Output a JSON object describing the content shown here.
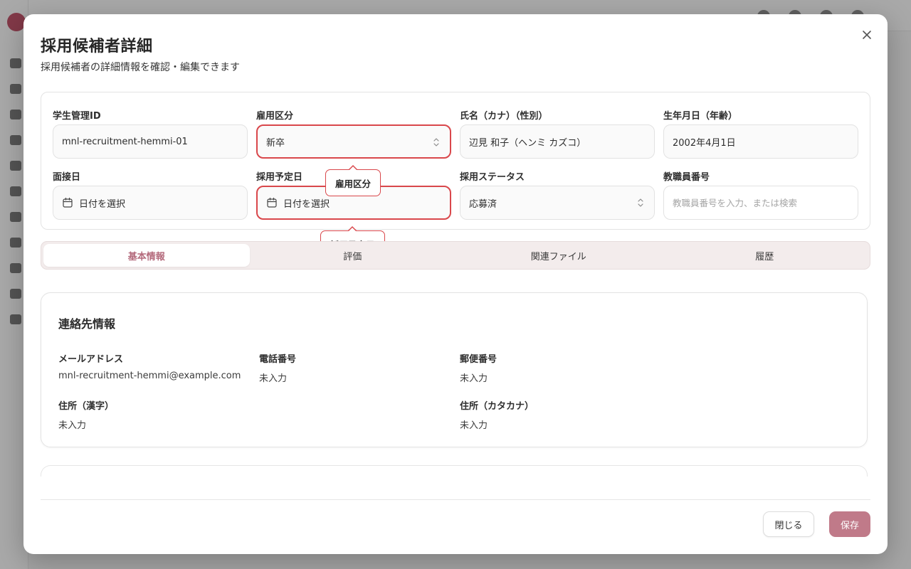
{
  "modal": {
    "title": "採用候補者詳細",
    "subtitle": "採用候補者の詳細情報を確認・編集できます"
  },
  "form": {
    "student_id": {
      "label": "学生管理ID",
      "value": "mnl-recruitment-hemmi-01"
    },
    "employment_type": {
      "label": "雇用区分",
      "value": "新卒"
    },
    "name": {
      "label": "氏名（カナ）（性別）",
      "value": "辺見 和子（ヘンミ カズコ）"
    },
    "birthdate": {
      "label": "生年月日（年齢）",
      "value": "2002年4月1日"
    },
    "interview_date": {
      "label": "面接日",
      "value": "日付を選択"
    },
    "planned_hire_date": {
      "label": "採用予定日",
      "value": "日付を選択"
    },
    "hire_status": {
      "label": "採用ステータス",
      "value": "応募済"
    },
    "staff_number": {
      "label": "教職員番号",
      "placeholder": "教職員番号を入力、または検索"
    }
  },
  "tooltips": {
    "employment_type": "雇用区分",
    "planned_hire_date": "採用予定日"
  },
  "tabs": [
    {
      "label": "基本情報",
      "active": true
    },
    {
      "label": "評価",
      "active": false
    },
    {
      "label": "関連ファイル",
      "active": false
    },
    {
      "label": "履歴",
      "active": false
    }
  ],
  "contact": {
    "title": "連絡先情報",
    "email": {
      "label": "メールアドレス",
      "value": "mnl-recruitment-hemmi@example.com"
    },
    "phone": {
      "label": "電話番号",
      "value": "未入力"
    },
    "postal": {
      "label": "郵便番号",
      "value": "未入力"
    },
    "address_kanji": {
      "label": "住所（漢字）",
      "value": "未入力"
    },
    "address_kana": {
      "label": "住所（カタカナ）",
      "value": "未入力"
    }
  },
  "footer": {
    "close_label": "閉じる",
    "save_label": "保存"
  },
  "colors": {
    "accent": "#c07a89",
    "active_tab_text": "#b46a7c",
    "highlight_border": "#d9474b"
  }
}
